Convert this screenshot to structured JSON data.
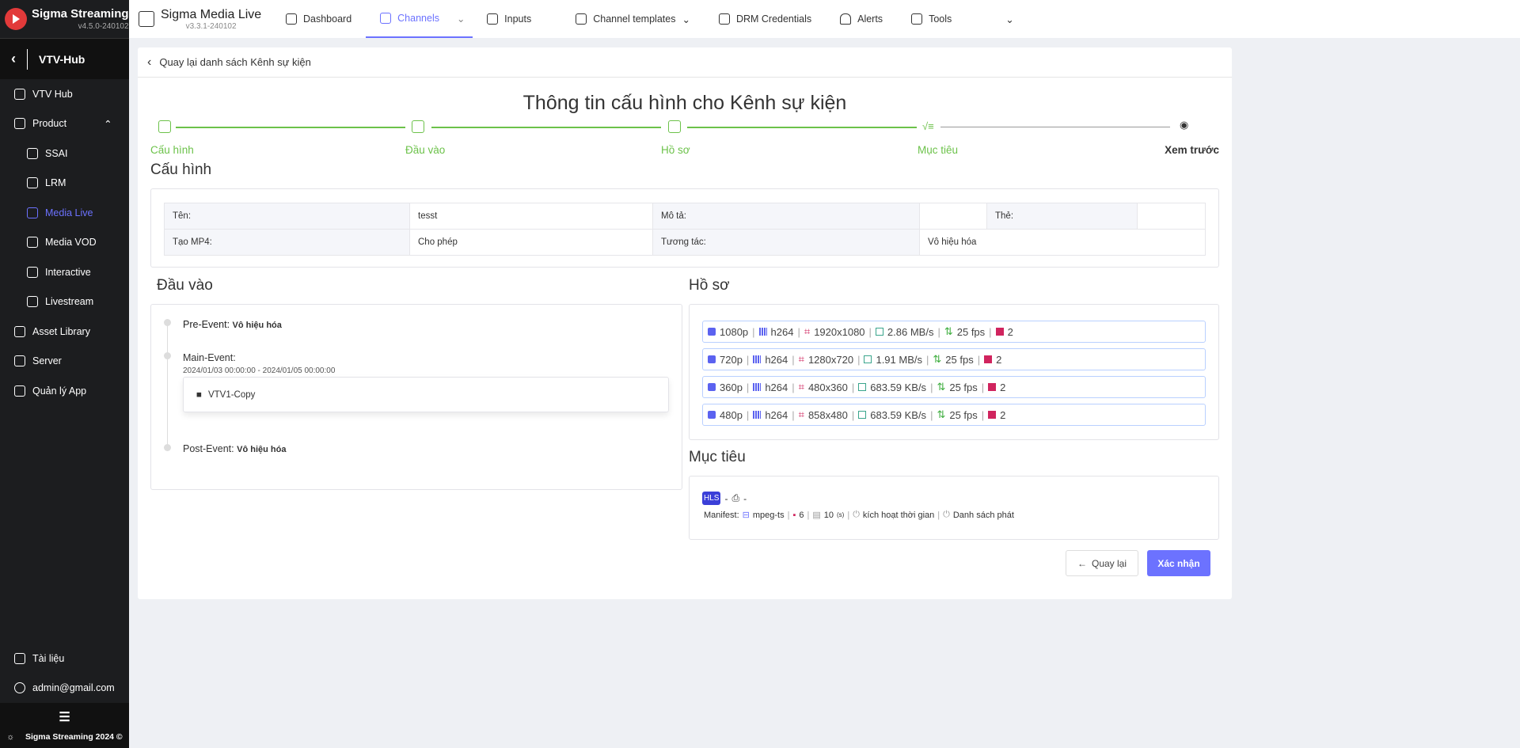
{
  "sidebar": {
    "brand": "Sigma Streaming",
    "version": "v4.5.0-240102",
    "hub": "VTV-Hub",
    "items": [
      {
        "label": "VTV Hub"
      },
      {
        "label": "Product"
      },
      {
        "label": "SSAI"
      },
      {
        "label": "LRM"
      },
      {
        "label": "Media Live"
      },
      {
        "label": "Media VOD"
      },
      {
        "label": "Interactive"
      },
      {
        "label": "Livestream"
      },
      {
        "label": "Asset Library"
      },
      {
        "label": "Server"
      },
      {
        "label": "Quản lý App"
      }
    ],
    "docs": "Tài liệu",
    "user": "admin@gmail.com",
    "footer": "Sigma Streaming 2024 ©"
  },
  "topbar": {
    "app": "Sigma Media Live",
    "version": "v3.3.1-240102",
    "tabs": [
      {
        "label": "Dashboard"
      },
      {
        "label": "Channels"
      },
      {
        "label": "Inputs"
      },
      {
        "label": "Channel templates"
      },
      {
        "label": "DRM Credentials"
      },
      {
        "label": "Alerts"
      },
      {
        "label": "Tools"
      }
    ]
  },
  "page": {
    "back": "Quay lại danh sách Kênh sự kiện",
    "title": "Thông tin cấu hình cho Kênh sự kiện",
    "steps": [
      "Cấu hình",
      "Đầu vào",
      "Hồ sơ",
      "Mục tiêu",
      "Xem trước"
    ],
    "config": {
      "heading": "Cấu hình",
      "name_k": "Tên:",
      "name_v": "tesst",
      "desc_k": "Mô tả:",
      "desc_v": "",
      "tag_k": "Thẻ:",
      "tag_v": "",
      "mp4_k": "Tạo MP4:",
      "mp4_v": "Cho phép",
      "inter_k": "Tương tác:",
      "inter_v": "Vô hiệu hóa"
    },
    "input": {
      "heading": "Đầu vào",
      "pre_k": "Pre-Event:",
      "pre_v": "Vô hiệu hóa",
      "main_k": "Main-Event:",
      "main_time": "2024/01/03 00:00:00 - 2024/01/05 00:00:00",
      "source": "VTV1-Copy",
      "post_k": "Post-Event:",
      "post_v": "Vô hiệu hóa"
    },
    "profile": {
      "heading": "Hồ sơ",
      "rows": [
        {
          "res": "1080p",
          "codec": "h264",
          "size": "1920x1080",
          "rate": "2.86 MB/s",
          "fps": "25 fps",
          "ch": "2"
        },
        {
          "res": "720p",
          "codec": "h264",
          "size": "1280x720",
          "rate": "1.91 MB/s",
          "fps": "25 fps",
          "ch": "2"
        },
        {
          "res": "360p",
          "codec": "h264",
          "size": "480x360",
          "rate": "683.59 KB/s",
          "fps": "25 fps",
          "ch": "2"
        },
        {
          "res": "480p",
          "codec": "h264",
          "size": "858x480",
          "rate": "683.59 KB/s",
          "fps": "25 fps",
          "ch": "2"
        }
      ]
    },
    "target": {
      "heading": "Mục tiêu",
      "badge": "HLS",
      "dash1": "-",
      "dash2": "-",
      "manifest": "Manifest:",
      "container": "mpeg-ts",
      "segments": "6",
      "duration": "10",
      "unit": "(s)",
      "timer": "kích hoạt thời gian",
      "playlist": "Danh sách phát"
    },
    "buttons": {
      "back": "Quay lại",
      "confirm": "Xác nhận"
    }
  },
  "colors": {
    "accent": "#6c72ff",
    "success": "#6cc24a",
    "hls": "#3b3fd8"
  }
}
